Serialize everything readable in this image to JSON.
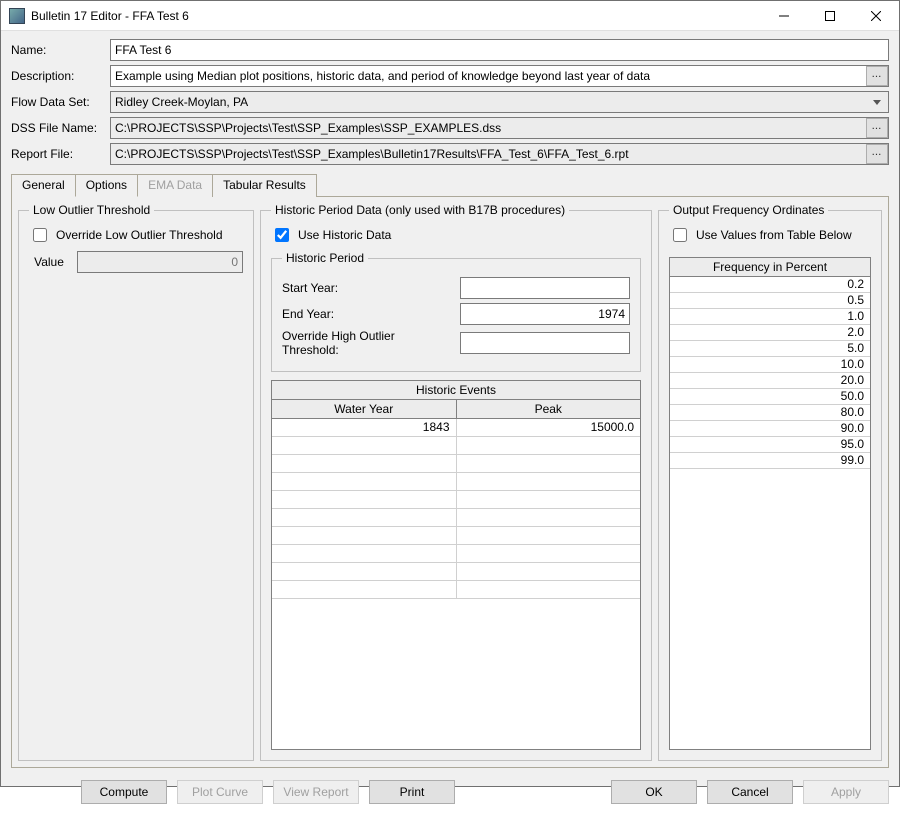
{
  "window": {
    "title": "Bulletin 17 Editor - FFA Test 6"
  },
  "form": {
    "name_label": "Name:",
    "name_value": "FFA Test 6",
    "desc_label": "Description:",
    "desc_value": "Example using Median plot positions, historic data, and period of knowledge beyond last year of data",
    "flow_label": "Flow Data Set:",
    "flow_value": "Ridley Creek-Moylan, PA",
    "dss_label": "DSS File Name:",
    "dss_value": "C:\\PROJECTS\\SSP\\Projects\\Test\\SSP_Examples\\SSP_EXAMPLES.dss",
    "rpt_label": "Report File:",
    "rpt_value": "C:\\PROJECTS\\SSP\\Projects\\Test\\SSP_Examples\\Bulletin17Results\\FFA_Test_6\\FFA_Test_6.rpt"
  },
  "tabs": {
    "general": "General",
    "options": "Options",
    "ema": "EMA Data",
    "tabular": "Tabular Results"
  },
  "low": {
    "legend": "Low Outlier Threshold",
    "override": "Override Low Outlier Threshold",
    "value_label": "Value",
    "value_placeholder": "0"
  },
  "hist": {
    "legend": "Historic Period Data (only used with B17B procedures)",
    "use": "Use Historic Data",
    "hp_legend": "Historic Period",
    "start": "Start Year:",
    "start_value": "",
    "end": "End Year:",
    "end_value": "1974",
    "ohot": "Override High Outlier Threshold:",
    "ohot_value": "",
    "events_title": "Historic Events",
    "col_wy": "Water Year",
    "col_pk": "Peak",
    "events": [
      {
        "wy": "1843",
        "pk": "15000.0"
      }
    ],
    "blank_rows": 9
  },
  "freq": {
    "legend": "Output Frequency Ordinates",
    "use": "Use Values from Table Below",
    "header": "Frequency in Percent",
    "values": [
      "0.2",
      "0.5",
      "1.0",
      "2.0",
      "5.0",
      "10.0",
      "20.0",
      "50.0",
      "80.0",
      "90.0",
      "95.0",
      "99.0"
    ]
  },
  "buttons": {
    "compute": "Compute",
    "plot": "Plot Curve",
    "view": "View Report",
    "print": "Print",
    "ok": "OK",
    "cancel": "Cancel",
    "apply": "Apply"
  }
}
